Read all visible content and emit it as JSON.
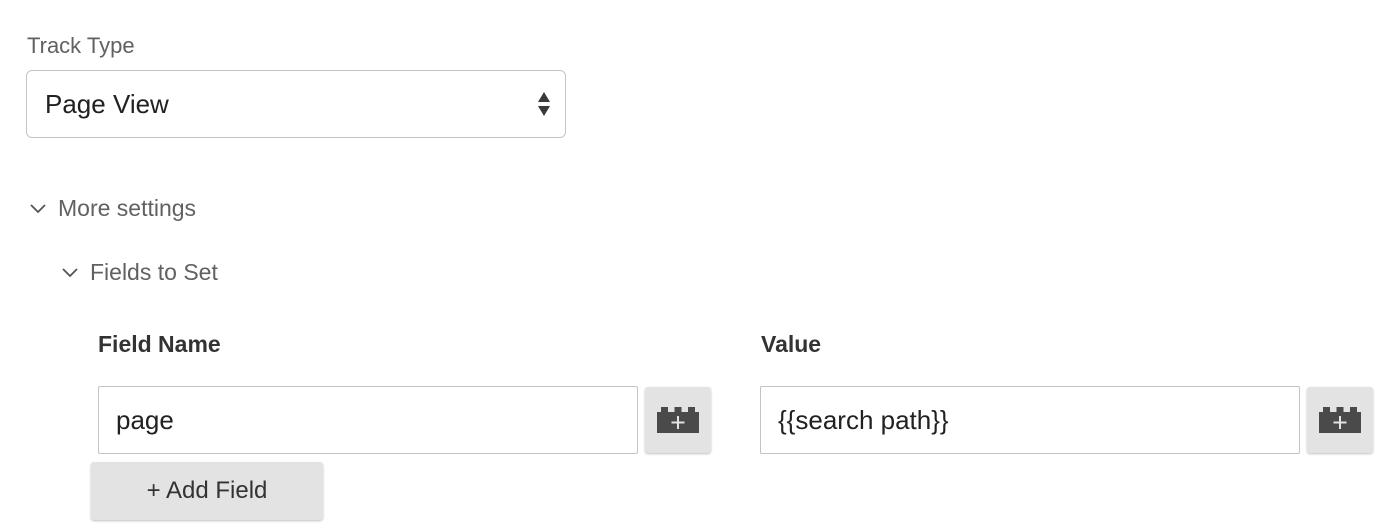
{
  "track_type": {
    "label": "Track Type",
    "selected": "Page View",
    "icon": "select-arrows-icon"
  },
  "more_settings": {
    "label": "More settings",
    "icon": "chevron-down-icon",
    "expanded": true
  },
  "fields_to_set": {
    "label": "Fields to Set",
    "icon": "chevron-down-icon",
    "expanded": true,
    "columns": {
      "field_name": "Field Name",
      "value": "Value"
    },
    "rows": [
      {
        "field_name": "page",
        "value": "{{search path}}",
        "field_variable_icon": "variable-brick-icon",
        "value_variable_icon": "variable-brick-icon"
      }
    ],
    "add_button_label": "+ Add Field"
  },
  "colors": {
    "border": "#c4c4c4",
    "button_bg": "#e3e3e3",
    "label_gray": "#616161",
    "icon_dark": "#4a4a4a"
  }
}
